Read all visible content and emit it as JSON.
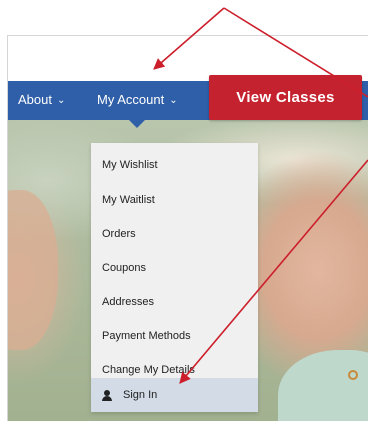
{
  "nav": {
    "about_label": "About",
    "account_label": "My Account",
    "chevron": "⌄",
    "cta_label": "View Classes"
  },
  "account_menu": {
    "items": [
      "My Wishlist",
      "My Waitlist",
      "Orders",
      "Coupons",
      "Addresses",
      "Payment Methods",
      "Change My Details"
    ],
    "sign_in_label": "Sign In",
    "sign_in_icon": "user-icon"
  },
  "colors": {
    "nav_bar": "#2f5fa8",
    "cta_button": "#c5222f",
    "dropdown_bg": "#f0f0f0",
    "active_item_bg": "#d2dbe6",
    "annotation_arrow": "#cc1f2b"
  }
}
